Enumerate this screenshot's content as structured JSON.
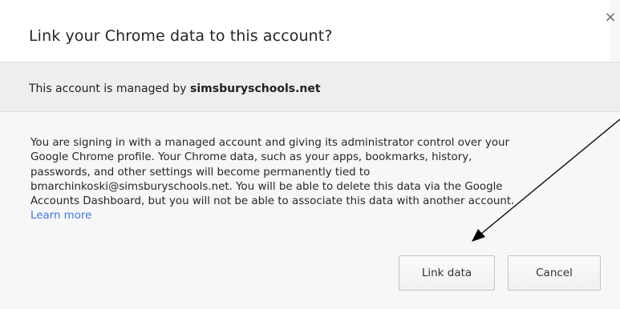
{
  "dialog": {
    "title": "Link your Chrome data to this account?",
    "close_label": "×",
    "managed_prefix": "This account is managed by ",
    "managed_domain": "simsburyschools.net",
    "body_lines": [
      "You are signing in with a managed account and giving its administrator control over your",
      "Google Chrome profile. Your Chrome data, such as your apps, bookmarks, history,",
      "passwords, and other settings will become permanently tied to",
      "bmarchinkoski@simsburyschools.net. You will be able to delete this data via the Google",
      "Accounts Dashboard, but you will not be able to associate this data with another account."
    ],
    "learn_more": "Learn more",
    "link_button": "Link data",
    "cancel_button": "Cancel",
    "link_color": "#3b78e7",
    "annotation_arrow_color": "#000000"
  }
}
